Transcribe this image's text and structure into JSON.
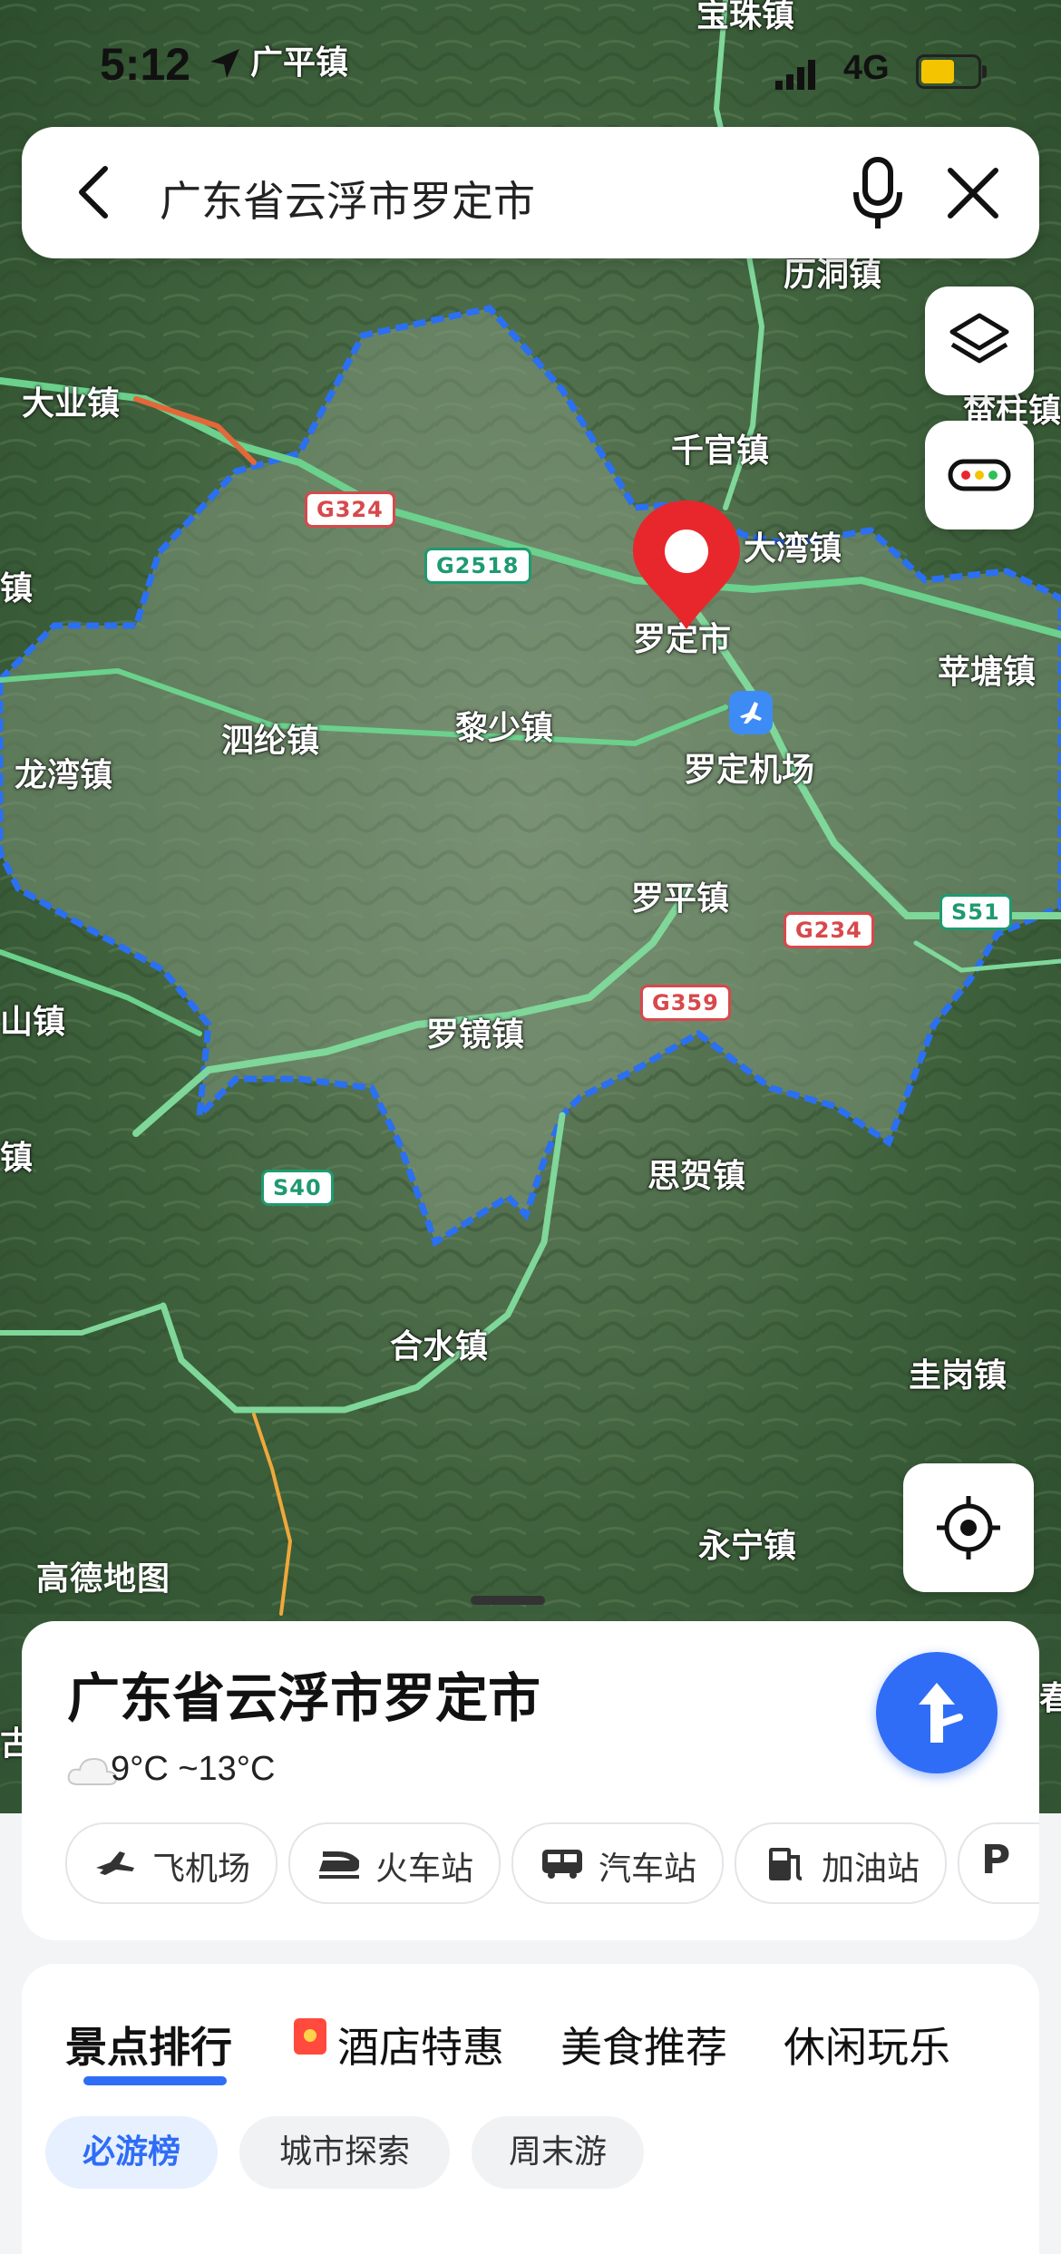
{
  "status_bar": {
    "time": "5:12",
    "network": "4G",
    "battery_level": 0.6
  },
  "search": {
    "query": "广东省云浮市罗定市"
  },
  "map": {
    "towns": {
      "baozhu": "宝珠镇",
      "guangping": "广平镇",
      "lidong": "历洞镇",
      "daye": "大业镇",
      "songzhu": "榃柱镇",
      "qianguan": "千官镇",
      "dawan": "大湾镇",
      "luoding": "罗定市",
      "pingtang": "苹塘镇",
      "silun": "泗纶镇",
      "lishao": "黎少镇",
      "airport": "罗定机场",
      "longwan": "龙湾镇",
      "luoping": "罗平镇",
      "luojing": "罗镜镇",
      "shan": "山镇",
      "sihe": "思贺镇",
      "heshui": "合水镇",
      "weigang": "圭岗镇",
      "yongning": "永宁镇",
      "edge_zhen_1": "镇",
      "edge_zhen_2": "镇",
      "edge_chun": "春",
      "edge_gu": "古"
    },
    "roads": {
      "g324": "G324",
      "g2518": "G2518",
      "g234": "G234",
      "s51": "S51",
      "g359": "G359",
      "s40": "S40"
    },
    "logo": "高德地图",
    "colors": {
      "boundary": "#2b6ff2",
      "pin": "#e8272c"
    }
  },
  "place": {
    "title": "广东省云浮市罗定市",
    "weather": "9°C ~13°C"
  },
  "quick_chips": [
    "飞机场",
    "火车站",
    "汽车站",
    "加油站",
    "P"
  ],
  "tabs": [
    "景点排行",
    "酒店特惠",
    "美食推荐",
    "休闲玩乐"
  ],
  "sub_tabs": [
    "必游榜",
    "城市探索",
    "周末游"
  ],
  "accent_color": "#2f6df6"
}
